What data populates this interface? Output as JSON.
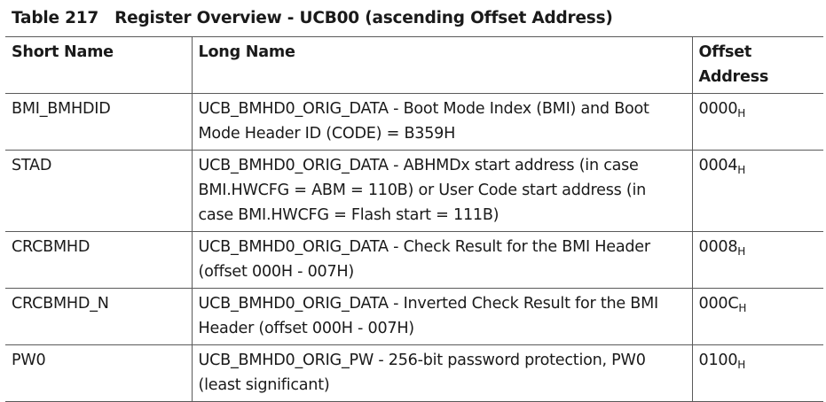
{
  "caption": {
    "number": "Table 217",
    "title": "Register Overview  - UCB00 (ascending Offset Address)"
  },
  "columns": [
    "Short Name",
    "Long Name",
    "Offset\nAddress"
  ],
  "rows": [
    {
      "short": "BMI_BMHDID",
      "long": "UCB_BMHD0_ORIG_DATA - Boot Mode Index (BMI) and Boot Mode Header ID (CODE) = B359H",
      "offset": "0000",
      "suffix": "H"
    },
    {
      "short": "STAD",
      "long": "UCB_BMHD0_ORIG_DATA - ABHMDx start address (in case BMI.HWCFG = ABM = 110B) or User Code start address (in case BMI.HWCFG = Flash start = 111B)",
      "offset": "0004",
      "suffix": "H"
    },
    {
      "short": "CRCBMHD",
      "long": "UCB_BMHD0_ORIG_DATA - Check Result for the BMI Header (offset 000H - 007H)",
      "offset": "0008",
      "suffix": "H"
    },
    {
      "short": "CRCBMHD_N",
      "long": "UCB_BMHD0_ORIG_DATA - Inverted Check Result for the BMI Header (offset 000H - 007H)",
      "offset": "000C",
      "suffix": "H"
    },
    {
      "short": "PW0",
      "long": "UCB_BMHD0_ORIG_PW - 256-bit password protection, PW0 (least significant)",
      "offset": "0100",
      "suffix": "H"
    }
  ]
}
